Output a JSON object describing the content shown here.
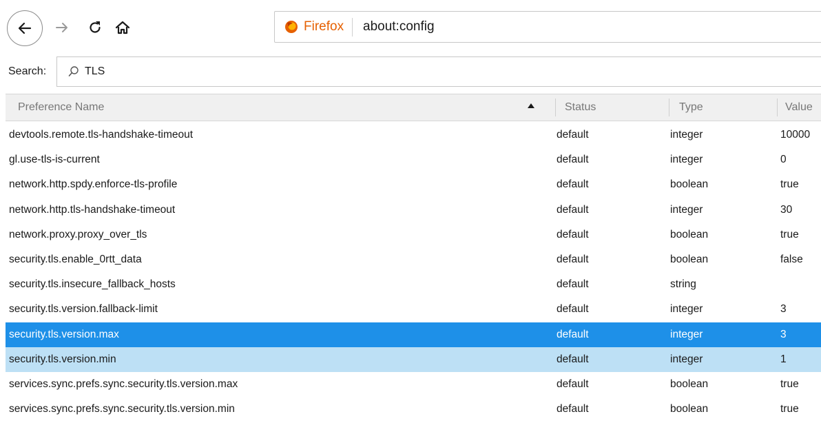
{
  "toolbar": {
    "identity_label": "Firefox",
    "url": "about:config",
    "brand_color": "#e66000"
  },
  "search": {
    "label": "Search:",
    "value": "TLS"
  },
  "table": {
    "columns": [
      "Preference Name",
      "Status",
      "Type",
      "Value"
    ],
    "sort_column": "Preference Name",
    "sort_direction": "ascending",
    "selection_color": "#1e90e8",
    "hover_color": "#bde0f5",
    "rows": [
      {
        "name": "devtools.remote.tls-handshake-timeout",
        "status": "default",
        "type": "integer",
        "value": "10000",
        "state": ""
      },
      {
        "name": "gl.use-tls-is-current",
        "status": "default",
        "type": "integer",
        "value": "0",
        "state": ""
      },
      {
        "name": "network.http.spdy.enforce-tls-profile",
        "status": "default",
        "type": "boolean",
        "value": "true",
        "state": ""
      },
      {
        "name": "network.http.tls-handshake-timeout",
        "status": "default",
        "type": "integer",
        "value": "30",
        "state": ""
      },
      {
        "name": "network.proxy.proxy_over_tls",
        "status": "default",
        "type": "boolean",
        "value": "true",
        "state": ""
      },
      {
        "name": "security.tls.enable_0rtt_data",
        "status": "default",
        "type": "boolean",
        "value": "false",
        "state": ""
      },
      {
        "name": "security.tls.insecure_fallback_hosts",
        "status": "default",
        "type": "string",
        "value": "",
        "state": ""
      },
      {
        "name": "security.tls.version.fallback-limit",
        "status": "default",
        "type": "integer",
        "value": "3",
        "state": ""
      },
      {
        "name": "security.tls.version.max",
        "status": "default",
        "type": "integer",
        "value": "3",
        "state": "selected"
      },
      {
        "name": "security.tls.version.min",
        "status": "default",
        "type": "integer",
        "value": "1",
        "state": "hover"
      },
      {
        "name": "services.sync.prefs.sync.security.tls.version.max",
        "status": "default",
        "type": "boolean",
        "value": "true",
        "state": ""
      },
      {
        "name": "services.sync.prefs.sync.security.tls.version.min",
        "status": "default",
        "type": "boolean",
        "value": "true",
        "state": ""
      }
    ]
  }
}
